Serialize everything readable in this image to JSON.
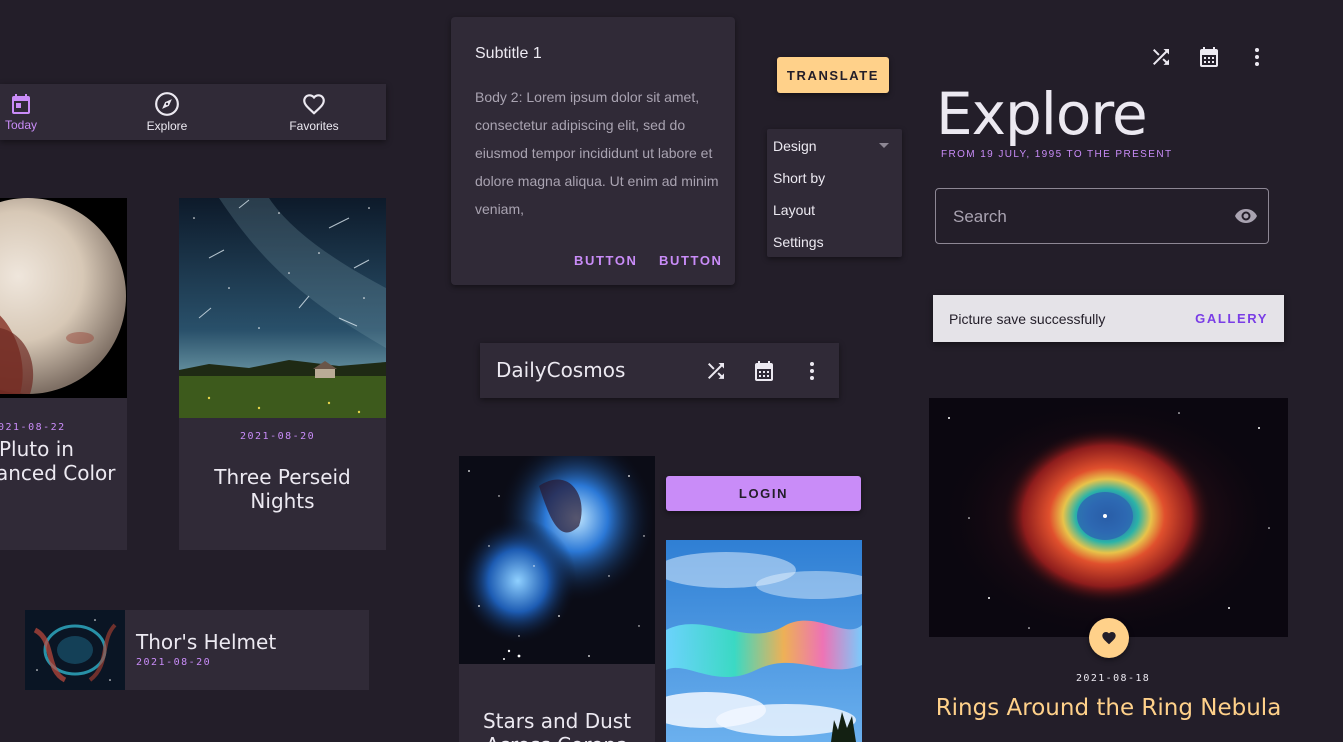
{
  "colors": {
    "background": "#231e29",
    "surface": "#302a37",
    "primary": "#c98cf8",
    "secondary": "#ffd18a",
    "snackbar_action": "#7a3ee6"
  },
  "bottom_nav": {
    "items": [
      {
        "label": "Today",
        "icon": "calendar-icon",
        "active": true
      },
      {
        "label": "Explore",
        "icon": "compass-icon",
        "active": false
      },
      {
        "label": "Favorites",
        "icon": "heart-icon",
        "active": false
      }
    ]
  },
  "cards": {
    "pluto": {
      "date": "021-08-22",
      "title_line1": "Pluto in",
      "title_line2": "anced Color"
    },
    "perseid": {
      "date": "2021-08-20",
      "title_line1": "Three Perseid",
      "title_line2": "Nights"
    },
    "thor": {
      "title": "Thor's Helmet",
      "date": "2021-08-20"
    },
    "stars": {
      "title_line1": "Stars and Dust",
      "title_line2": "Across Corona"
    }
  },
  "dialog": {
    "subtitle": "Subtitle 1",
    "body": "Body 2: Lorem ipsum dolor sit amet, consectetur adipiscing elit, sed do eiusmod tempor incididunt ut labore et dolore magna aliqua. Ut enim ad minim veniam,",
    "button1": "BUTTON",
    "button2": "BUTTON"
  },
  "toolbar": {
    "title": "DailyCosmos",
    "icons": [
      "shuffle-icon",
      "calendar-icon",
      "more-vert-icon"
    ]
  },
  "buttons": {
    "translate": "TRANSLATE",
    "login": "LOGIN"
  },
  "menu": {
    "selected": "Design",
    "items": [
      "Short by",
      "Layout",
      "Settings"
    ]
  },
  "explore": {
    "title": "Explore",
    "subtitle": "FROM 19 JULY, 1995 TO THE PRESENT",
    "search_placeholder": "Search",
    "top_icons": [
      "shuffle-icon",
      "calendar-icon",
      "more-vert-icon"
    ]
  },
  "snackbar": {
    "message": "Picture save successfully",
    "action": "GALLERY"
  },
  "featured": {
    "date": "2021-08-18",
    "title": "Rings Around the Ring Nebula"
  }
}
